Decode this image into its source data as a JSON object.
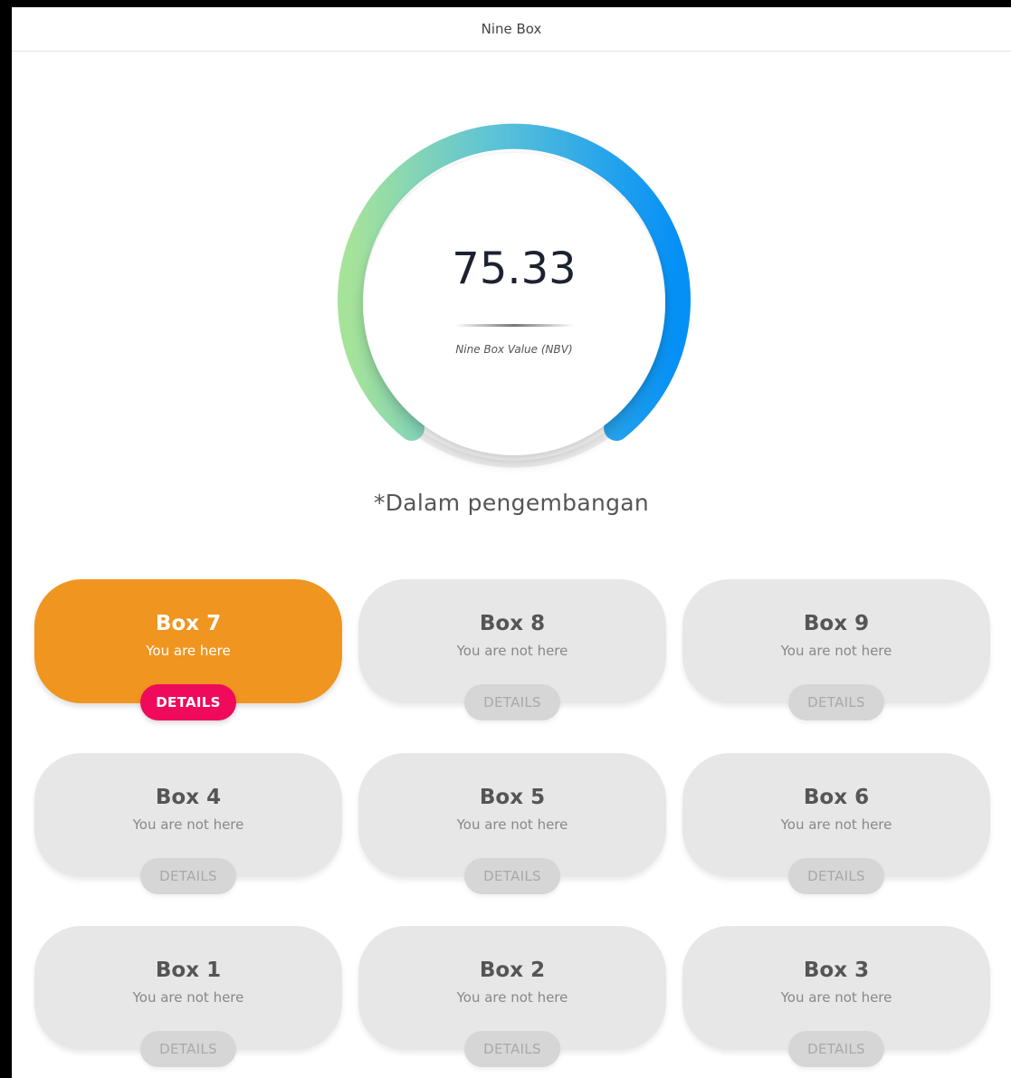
{
  "header": {
    "title": "Nine Box"
  },
  "gauge": {
    "value": "75.33",
    "caption": "Nine Box Value (NBV)",
    "gradient_start": "#a6e39a",
    "gradient_mid": "#5bc2d8",
    "gradient_end": "#0590f7",
    "track_color": "#eeeeee"
  },
  "note": "*Dalam pengembangan",
  "boxes": [
    {
      "title": "Box 7",
      "status": "You are here",
      "button": "DETAILS",
      "active": true
    },
    {
      "title": "Box 8",
      "status": "You are not here",
      "button": "DETAILS",
      "active": false
    },
    {
      "title": "Box 9",
      "status": "You are not here",
      "button": "DETAILS",
      "active": false
    },
    {
      "title": "Box 4",
      "status": "You are not here",
      "button": "DETAILS",
      "active": false
    },
    {
      "title": "Box 5",
      "status": "You are not here",
      "button": "DETAILS",
      "active": false
    },
    {
      "title": "Box 6",
      "status": "You are not here",
      "button": "DETAILS",
      "active": false
    },
    {
      "title": "Box 1",
      "status": "You are not here",
      "button": "DETAILS",
      "active": false
    },
    {
      "title": "Box 2",
      "status": "You are not here",
      "button": "DETAILS",
      "active": false
    },
    {
      "title": "Box 3",
      "status": "You are not here",
      "button": "DETAILS",
      "active": false
    }
  ],
  "colors": {
    "active_box": "#f0951f",
    "active_button": "#ef0a5c",
    "inactive_box": "#e7e7e7",
    "inactive_button": "#d6d6d6"
  }
}
